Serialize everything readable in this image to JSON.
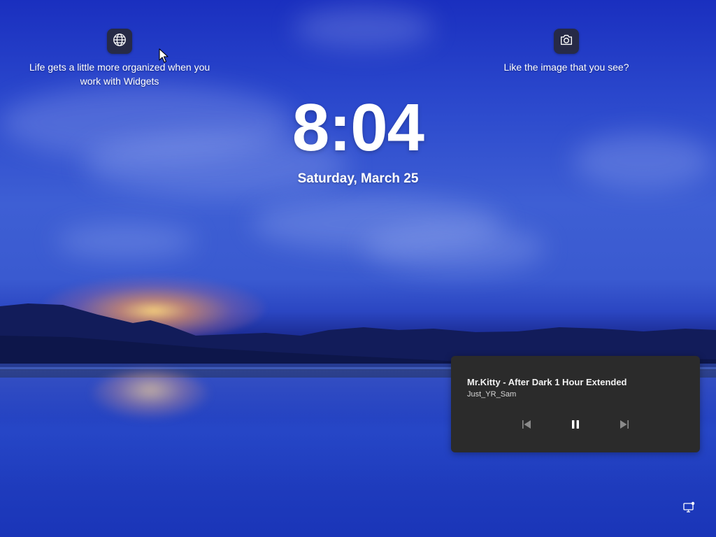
{
  "lock_screen": {
    "time": "8:04",
    "date": "Saturday, March 25"
  },
  "widgets_hint": {
    "icon": "globe-icon",
    "text": "Life gets a little more organized when you work with Widgets"
  },
  "spotlight_hint": {
    "icon": "camera-icon",
    "text": "Like the image that you see?"
  },
  "media_player": {
    "title": "Mr.Kitty - After Dark 1 Hour Extended",
    "artist": "Just_YR_Sam",
    "controls": {
      "previous_icon": "previous-track-icon",
      "pause_icon": "pause-icon",
      "next_icon": "next-track-icon"
    }
  },
  "system_tray": {
    "network_icon": "network-icon"
  },
  "colors": {
    "sky": "#2a47cc",
    "media_card_bg": "#2b2b2b",
    "hint_button_bg": "#28282f"
  }
}
